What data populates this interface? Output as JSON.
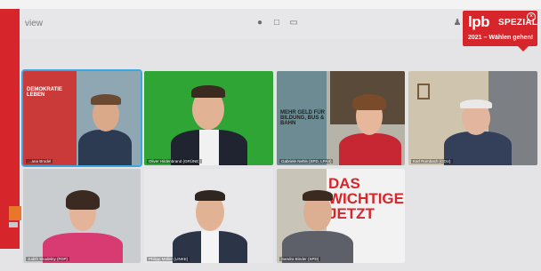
{
  "window": {
    "title": "view"
  },
  "toolbar": {
    "icons": [
      "mic-icon",
      "chat-icon",
      "screen-icon",
      "people-icon"
    ]
  },
  "brand": {
    "logo_text": "lpb",
    "spezial": "SPEZIAL",
    "subtitle": "2021 – Wählen gehen!",
    "color": "#d7262b"
  },
  "participants": [
    {
      "name": "…ana Brodel",
      "background": "#8fa6b3",
      "active": true,
      "poster": "DEMOKRATIE LEBEN"
    },
    {
      "name": "Oliver Hildenbrand (GRÜNE)",
      "background": "#2ea535",
      "active": false
    },
    {
      "name": "Gabriele Nehls (SPD, LPA4)",
      "background": "#b6b3a9",
      "active": false,
      "poster": "MEHR GELD FÜR BILDUNG, BUS & BAHN"
    },
    {
      "name": "Karl Rombach (CDU)",
      "background": "#cfc4ad",
      "active": false
    },
    {
      "name": "Judith Skudelny (FDP)",
      "background": "#c9cdd0",
      "active": false
    },
    {
      "name": "Philipp Müller (LINKE)",
      "background": "#e8e8ea",
      "active": false
    },
    {
      "name": "Sandra Binder (SPD)",
      "background": "#c8c4b8",
      "active": false,
      "poster": "DAS WICHTIGE JETZT"
    }
  ]
}
